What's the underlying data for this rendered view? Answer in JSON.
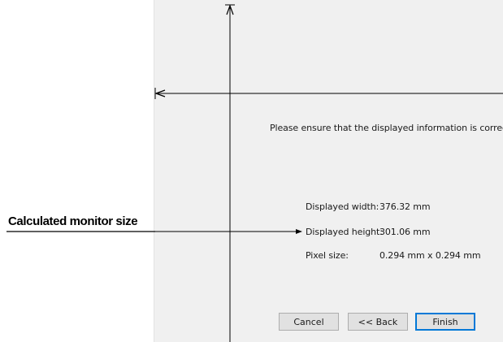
{
  "instruction": "Please ensure that the displayed information is correct.",
  "info": {
    "width_label": "Displayed width:",
    "width_value": "376.32 mm",
    "height_label": "Displayed height:",
    "height_value": "301.06 mm",
    "pixel_label": "Pixel size:",
    "pixel_value": "0.294 mm x 0.294 mm"
  },
  "callout": {
    "label": "Calculated monitor size"
  },
  "buttons": {
    "cancel": "Cancel",
    "back": "<< Back",
    "finish": "Finish"
  },
  "colors": {
    "dialog_bg": "#f0f0f0",
    "button_bg": "#e1e1e1",
    "default_button_border": "#0078d7"
  }
}
